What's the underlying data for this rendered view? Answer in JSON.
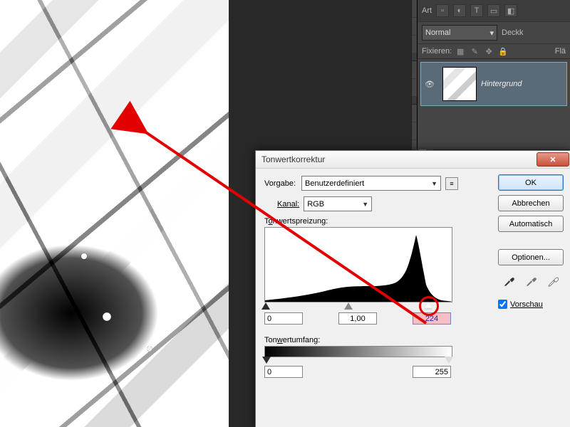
{
  "panel": {
    "art_label": "Art",
    "blend_mode": "Normal",
    "opacity_label": "Deckk",
    "lock_label": "Fixieren:",
    "fill_label": "Flä",
    "layer_name": "Hintergrund"
  },
  "dialog": {
    "title": "Tonwertkorrektur",
    "preset_label": "Vorgabe:",
    "preset_value": "Benutzerdefiniert",
    "channel_label": "Kanal:",
    "channel_value": "RGB",
    "input_label_pre": "T",
    "input_label_ul": "o",
    "input_label_post": "nwertspreizung:",
    "black": "0",
    "mid": "1,00",
    "white": "224",
    "output_label_pre": "Ton",
    "output_label_ul": "w",
    "output_label_post": "ertumfang:",
    "out_black": "0",
    "out_white": "255",
    "ok": "OK",
    "cancel": "Abbrechen",
    "auto": "Automatisch",
    "options": "Optionen...",
    "preview": "Vorschau"
  },
  "chart_data": {
    "type": "area",
    "title": "Tonwertspreizung",
    "xlabel": "",
    "ylabel": "",
    "xlim": [
      0,
      255
    ],
    "values_approx_percent": [
      2,
      2,
      3,
      3,
      4,
      4,
      5,
      5,
      6,
      7,
      8,
      9,
      11,
      13,
      15,
      17,
      19,
      20,
      20,
      20,
      20,
      20,
      20,
      21,
      22,
      23,
      26,
      34,
      50,
      72,
      95,
      78,
      45,
      22,
      10,
      4,
      2,
      1
    ],
    "input_sliders": {
      "black": 0,
      "gamma": 1.0,
      "white": 224
    },
    "output_sliders": {
      "black": 0,
      "white": 255
    }
  }
}
